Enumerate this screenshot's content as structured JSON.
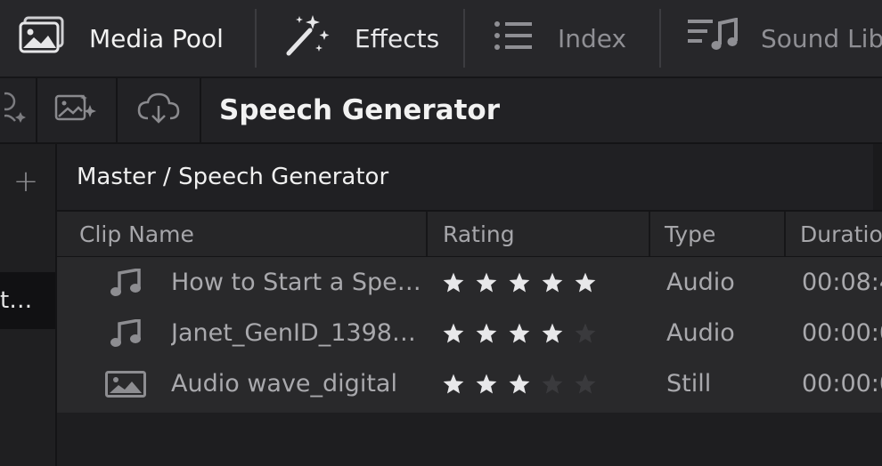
{
  "toolbar": {
    "items": [
      {
        "label": "Media Pool",
        "icon": "media-pool-icon"
      },
      {
        "label": "Effects",
        "icon": "magic-wand-icon"
      },
      {
        "label": "Index",
        "icon": "list-icon"
      },
      {
        "label": "Sound Lib",
        "icon": "sound-library-icon"
      }
    ]
  },
  "subbar": {
    "title": "Speech Generator",
    "buttons": [
      {
        "icon": "sparkle-person-icon"
      },
      {
        "icon": "image-sparkle-icon"
      },
      {
        "icon": "cloud-download-icon"
      }
    ]
  },
  "bins": {
    "add_symbol": "+",
    "selected_label": "t…"
  },
  "breadcrumb": "Master / Speech Generator",
  "table": {
    "columns": [
      "Clip Name",
      "Rating",
      "Type",
      "Duratio"
    ],
    "rows": [
      {
        "icon": "audio-note-icon",
        "name": "How to Start a Spe…",
        "rating": 5,
        "type": "Audio",
        "duration": "00:08:4"
      },
      {
        "icon": "audio-note-icon",
        "name": "Janet_GenID_1398…",
        "rating": 4,
        "type": "Audio",
        "duration": "00:00:0"
      },
      {
        "icon": "image-icon",
        "name": "Audio wave_digital",
        "rating": 3,
        "type": "Still",
        "duration": "00:00:0"
      }
    ]
  },
  "colors": {
    "background": "#1c1c1e",
    "star_on": "#e8e8ea",
    "star_off": "#3a3a3d"
  }
}
